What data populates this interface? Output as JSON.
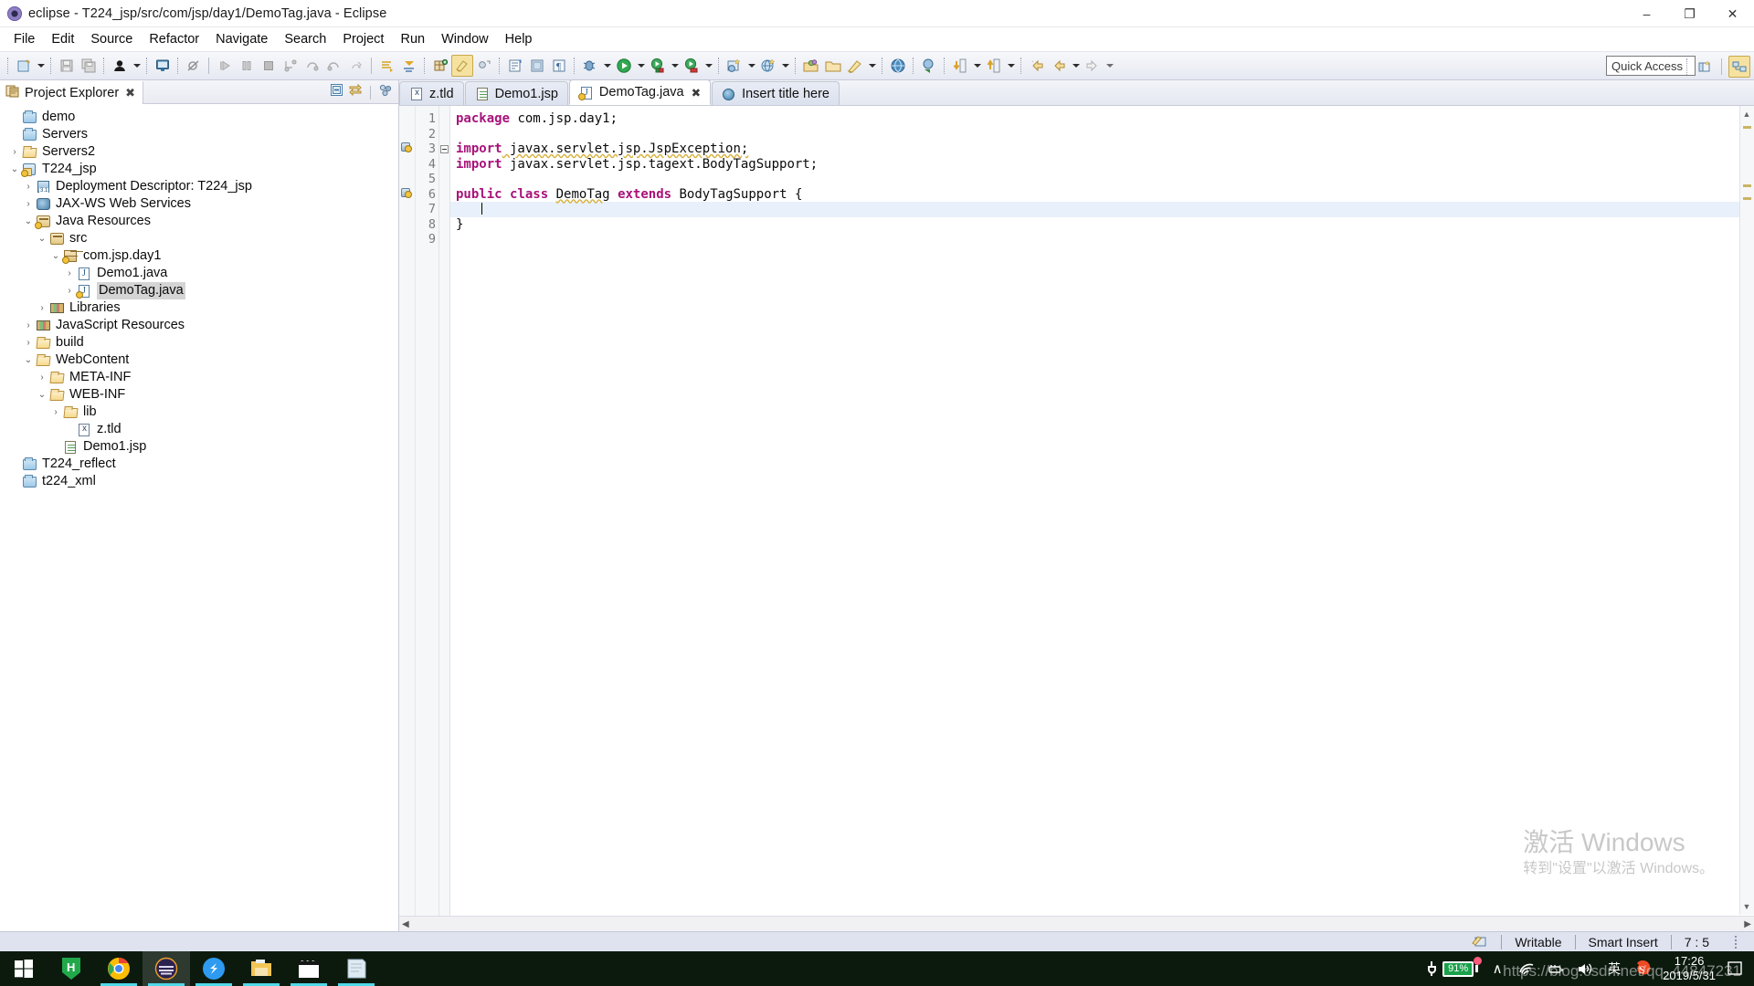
{
  "window": {
    "title": "eclipse - T224_jsp/src/com/jsp/day1/DemoTag.java - Eclipse",
    "app_icon": "eclipse-icon",
    "minimize": "–",
    "maximize": "❐",
    "close": "✕"
  },
  "menubar": {
    "items": [
      {
        "label": "File"
      },
      {
        "label": "Edit"
      },
      {
        "label": "Source"
      },
      {
        "label": "Refactor"
      },
      {
        "label": "Navigate"
      },
      {
        "label": "Search"
      },
      {
        "label": "Project"
      },
      {
        "label": "Run"
      },
      {
        "label": "Window"
      },
      {
        "label": "Help"
      }
    ]
  },
  "toolbar": {
    "quick_access_placeholder": "Quick Access",
    "buttons": [
      {
        "name": "new-wizard-icon"
      },
      {
        "name": "save-icon"
      },
      {
        "name": "save-all-icon"
      },
      {
        "name": "user-icon"
      },
      {
        "name": "console-icon"
      },
      {
        "name": "skip-breakpoints-icon"
      },
      {
        "name": "resume-icon"
      },
      {
        "name": "suspend-icon"
      },
      {
        "name": "terminate-icon"
      },
      {
        "name": "step-into-icon"
      },
      {
        "name": "step-over-icon"
      },
      {
        "name": "step-return-icon"
      },
      {
        "name": "drop-to-frame-icon"
      },
      {
        "name": "next-annotation-icon"
      },
      {
        "name": "previous-annotation-icon"
      },
      {
        "name": "new-java-package-icon"
      },
      {
        "name": "new-java-class-icon"
      },
      {
        "name": "new-java-interface-icon"
      },
      {
        "name": "open-type-icon"
      },
      {
        "name": "open-task-icon"
      },
      {
        "name": "pilcrow-icon"
      },
      {
        "name": "debug-icon"
      },
      {
        "name": "run-icon"
      },
      {
        "name": "run-server-icon"
      },
      {
        "name": "stop-server-icon"
      },
      {
        "name": "new-server-icon"
      },
      {
        "name": "new-dynamic-project-icon"
      },
      {
        "name": "open-perspective-icon"
      },
      {
        "name": "open-folder-icon"
      },
      {
        "name": "edit-icon"
      },
      {
        "name": "web-browser-icon"
      },
      {
        "name": "deploy-icon"
      },
      {
        "name": "export-icon"
      },
      {
        "name": "import-icon"
      },
      {
        "name": "back-icon"
      },
      {
        "name": "back2-icon"
      },
      {
        "name": "forward-icon"
      }
    ],
    "perspective_buttons": [
      {
        "name": "open-perspective-button"
      },
      {
        "name": "java-ee-perspective-button"
      }
    ]
  },
  "explorer": {
    "tab_label": "Project Explorer",
    "tab_icon": "project-explorer-icon",
    "close_glyph": "✖",
    "tools": [
      {
        "name": "collapse-all-button"
      },
      {
        "name": "link-with-editor-button"
      },
      {
        "name": "view-menu-button"
      }
    ],
    "tree": [
      {
        "label": "demo",
        "indent": 0,
        "twist": "",
        "icon": "folder-blue"
      },
      {
        "label": "Servers",
        "indent": 0,
        "twist": "",
        "icon": "folder-blue"
      },
      {
        "label": "Servers2",
        "indent": 0,
        "twist": "›",
        "icon": "folder-open"
      },
      {
        "label": "T224_jsp",
        "indent": 0,
        "twist": "⌄",
        "icon": "project-warn"
      },
      {
        "label": "Deployment Descriptor: T224_jsp",
        "indent": 1,
        "twist": "›",
        "icon": "deployment-descriptor"
      },
      {
        "label": "JAX-WS Web Services",
        "indent": 1,
        "twist": "›",
        "icon": "web-service"
      },
      {
        "label": "Java Resources",
        "indent": 1,
        "twist": "⌄",
        "icon": "java-resources-warn"
      },
      {
        "label": "src",
        "indent": 2,
        "twist": "⌄",
        "icon": "source-folder"
      },
      {
        "label": "com.jsp.day1",
        "indent": 3,
        "twist": "⌄",
        "icon": "package-warn"
      },
      {
        "label": "Demo1.java",
        "indent": 4,
        "twist": "›",
        "icon": "java-file"
      },
      {
        "label": "DemoTag.java",
        "indent": 4,
        "twist": "›",
        "icon": "java-file-warn",
        "selected": true
      },
      {
        "label": "Libraries",
        "indent": 2,
        "twist": "›",
        "icon": "library"
      },
      {
        "label": "JavaScript Resources",
        "indent": 1,
        "twist": "›",
        "icon": "library"
      },
      {
        "label": "build",
        "indent": 1,
        "twist": "›",
        "icon": "folder-open"
      },
      {
        "label": "WebContent",
        "indent": 1,
        "twist": "⌄",
        "icon": "folder-open"
      },
      {
        "label": "META-INF",
        "indent": 2,
        "twist": "›",
        "icon": "folder-open"
      },
      {
        "label": "WEB-INF",
        "indent": 2,
        "twist": "⌄",
        "icon": "folder-open"
      },
      {
        "label": "lib",
        "indent": 3,
        "twist": "›",
        "icon": "folder-open"
      },
      {
        "label": "z.tld",
        "indent": 4,
        "twist": "",
        "icon": "xml-file"
      },
      {
        "label": "Demo1.jsp",
        "indent": 3,
        "twist": "",
        "icon": "jsp-file"
      },
      {
        "label": "T224_reflect",
        "indent": 0,
        "twist": "",
        "icon": "folder-blue"
      },
      {
        "label": "t224_xml",
        "indent": 0,
        "twist": "",
        "icon": "folder-blue"
      }
    ]
  },
  "editor": {
    "tabs": [
      {
        "label": "z.tld",
        "icon": "xml-file",
        "active": false,
        "closable": false
      },
      {
        "label": "Demo1.jsp",
        "icon": "jsp-file",
        "active": false,
        "closable": false
      },
      {
        "label": "DemoTag.java",
        "icon": "java-file-warn",
        "active": true,
        "closable": true,
        "close_glyph": "✖"
      },
      {
        "label": "Insert title here",
        "icon": "web-page",
        "active": false,
        "closable": false
      }
    ],
    "line_numbers": [
      "1",
      "2",
      "3",
      "4",
      "5",
      "6",
      "7",
      "8",
      "9"
    ],
    "lines": [
      {
        "n": 1,
        "segments": [
          {
            "t": "package",
            "c": "kw"
          },
          {
            "t": " com.jsp.day1;",
            "c": "plain"
          }
        ]
      },
      {
        "n": 2,
        "segments": []
      },
      {
        "n": 3,
        "segments": [
          {
            "t": "import",
            "c": "kw"
          },
          {
            "t": " javax.servlet.jsp.JspException;",
            "c": "warn"
          }
        ],
        "fold": true,
        "annotation": "warning"
      },
      {
        "n": 4,
        "segments": [
          {
            "t": "import",
            "c": "kw"
          },
          {
            "t": " javax.servlet.jsp.tagext.BodyTagSupport;",
            "c": "plain"
          }
        ]
      },
      {
        "n": 5,
        "segments": []
      },
      {
        "n": 6,
        "segments": [
          {
            "t": "public",
            "c": "kw"
          },
          {
            "t": " ",
            "c": "plain"
          },
          {
            "t": "class",
            "c": "kw"
          },
          {
            "t": " ",
            "c": "plain"
          },
          {
            "t": "DemoTag",
            "c": "warn"
          },
          {
            "t": " ",
            "c": "plain"
          },
          {
            "t": "extends",
            "c": "kw"
          },
          {
            "t": " BodyTagSupport {",
            "c": "plain"
          }
        ],
        "annotation": "warning"
      },
      {
        "n": 7,
        "segments": [],
        "current": true,
        "caret": true
      },
      {
        "n": 8,
        "segments": [
          {
            "t": "}",
            "c": "plain"
          }
        ]
      },
      {
        "n": 9,
        "segments": []
      }
    ],
    "watermark": {
      "line1": "激活 Windows",
      "line2": "转到\"设置\"以激活 Windows。"
    }
  },
  "statusbar": {
    "icon": "writable-indicator-icon",
    "writable": "Writable",
    "insert_mode": "Smart Insert",
    "position": "7 : 5"
  },
  "taskbar": {
    "items": [
      {
        "name": "start-button",
        "icon": "windows-logo",
        "running": false,
        "focused": false
      },
      {
        "name": "taskbar-hbuilder",
        "icon": "h-logo",
        "running": false,
        "focused": false
      },
      {
        "name": "taskbar-chrome",
        "icon": "chrome-logo",
        "running": true,
        "focused": false
      },
      {
        "name": "taskbar-eclipse",
        "icon": "eclipse-logo",
        "running": true,
        "focused": true
      },
      {
        "name": "taskbar-explorer-s",
        "icon": "s-logo",
        "running": true,
        "focused": false
      },
      {
        "name": "taskbar-file-explorer",
        "icon": "folder-logo",
        "running": true,
        "focused": false
      },
      {
        "name": "taskbar-video",
        "icon": "clapper-logo",
        "running": true,
        "focused": false
      },
      {
        "name": "taskbar-notepad",
        "icon": "notepad-logo",
        "running": true,
        "focused": false
      }
    ],
    "tray": {
      "battery_percent": "91%",
      "chevron": "∧",
      "wifi": "wifi-icon",
      "input": "ime-icon",
      "volume": "volume-icon",
      "ime_label": "英",
      "sogou": "sogou-icon",
      "time": "17:26",
      "date": "2019/5/31",
      "notification": "action-center-icon"
    },
    "watermark": "https://blog.csdn.net/qq_44847231"
  }
}
